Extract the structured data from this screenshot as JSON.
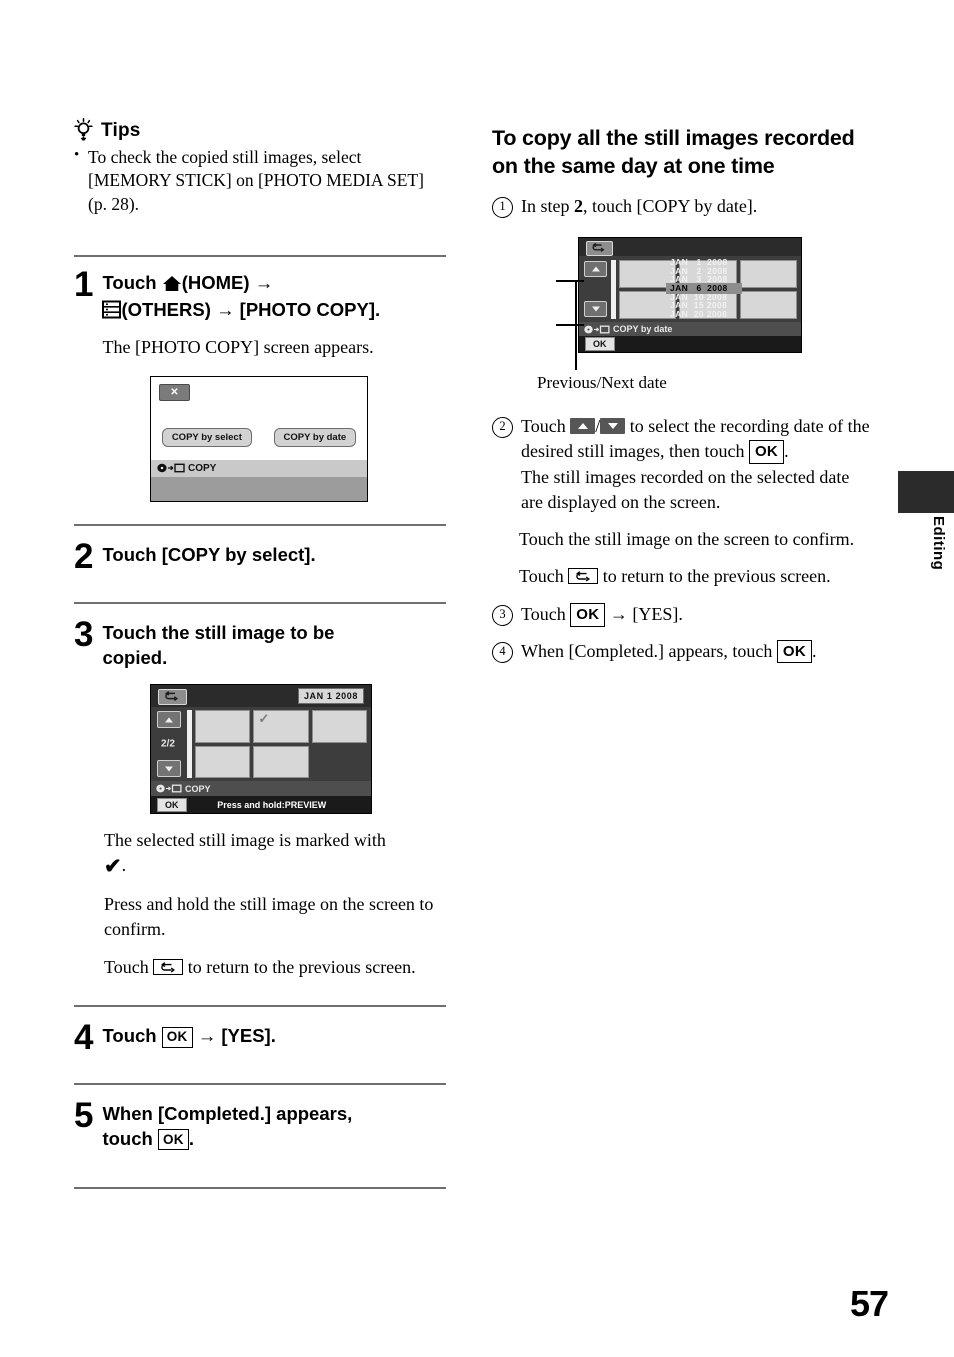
{
  "page": {
    "number": "57",
    "side_tab_label": "Editing"
  },
  "tips": {
    "title": "Tips",
    "icon": "lightbulb-icon",
    "items": [
      "To check the copied still images, select [MEMORY STICK] on [PHOTO MEDIA SET] (p. 28)."
    ]
  },
  "left_column": {
    "steps": [
      {
        "number": "1",
        "head_line1_pre": "Touch ",
        "head_line1_home": "(HOME)",
        "head_line2_others": "(OTHERS)",
        "head_line2_post": "[PHOTO COPY].",
        "sub": "The [PHOTO COPY] screen appears."
      },
      {
        "number": "2",
        "head": "Touch [COPY by select]."
      },
      {
        "number": "3",
        "head_line1": "Touch the still image to be",
        "head_line2": "copied.",
        "paras": [
          {
            "pre": "The selected still image is marked with",
            "glyph": "checkmark-icon",
            "post": "."
          },
          {
            "text": "Press and hold the still image on the screen to confirm."
          },
          {
            "pre": "Touch ",
            "glyph": "return-icon",
            "post": " to return to the previous screen."
          }
        ]
      },
      {
        "number": "4",
        "pre": "Touch ",
        "ok": "OK",
        "arrow": "→",
        "post": "[YES]."
      },
      {
        "number": "5",
        "line1": "When [Completed.] appears,",
        "line2_pre": "touch ",
        "ok": "OK",
        "line2_post": "."
      }
    ]
  },
  "screen_photo_copy": {
    "close_label": "✕",
    "buttons": [
      "COPY by select",
      "COPY by date"
    ],
    "status_label": "COPY",
    "status_icon": "disc-to-memorystick-icon"
  },
  "screen_thumbnail_grid": {
    "return_icon": "return-icon",
    "date_badge": "JAN  1 2008",
    "page_indicator": "2/2",
    "up_icon": "triangle-up-icon",
    "down_icon": "triangle-down-icon",
    "status_label": "COPY",
    "status_icon": "disc-to-memorystick-icon",
    "ok_label": "OK",
    "hint_label": "Press and hold:PREVIEW",
    "checked_cell_index": 1,
    "cells": 6
  },
  "screen_copy_by_date": {
    "return_icon": "return-icon",
    "up_icon": "triangle-up-icon",
    "down_icon": "triangle-down-icon",
    "dates": [
      {
        "text": "JAN   1  2008",
        "selected": false
      },
      {
        "text": "JAN   2  2008",
        "selected": false
      },
      {
        "text": "JAN   3  2008",
        "selected": false
      },
      {
        "text": "JAN   6  2008",
        "selected": true
      },
      {
        "text": "JAN  10 2008",
        "selected": false
      },
      {
        "text": "JAN  15 2008",
        "selected": false
      },
      {
        "text": "JAN  20 2008",
        "selected": false
      }
    ],
    "status_label": "COPY by date",
    "status_icon": "disc-to-memorystick-icon",
    "ok_label": "OK",
    "caption": "Previous/Next date"
  },
  "right_column": {
    "heading_line1": "To copy all the still images recorded",
    "heading_line2": "on the same day at one time",
    "items": [
      {
        "num": "1",
        "pre": "In step ",
        "bold": "2",
        "post": ", touch [COPY by date]."
      },
      {
        "num": "2",
        "t1": "Touch ",
        "slash": "/",
        "t2": " to select the recording date of the desired still images, then touch ",
        "ok": "OK",
        "t3": ".",
        "t4": "The still images recorded on the selected date are displayed on the screen."
      },
      {
        "num": "3",
        "pre": "Touch ",
        "ok": "OK",
        "arrow": "→",
        "post": "[YES]."
      },
      {
        "num": "4",
        "pre": "When [Completed.] appears, touch ",
        "ok": "OK",
        "post": "."
      }
    ],
    "para_confirm": "Touch the still image on the screen to confirm.",
    "para_return_pre": "Touch ",
    "para_return_post": " to return to the previous screen."
  }
}
